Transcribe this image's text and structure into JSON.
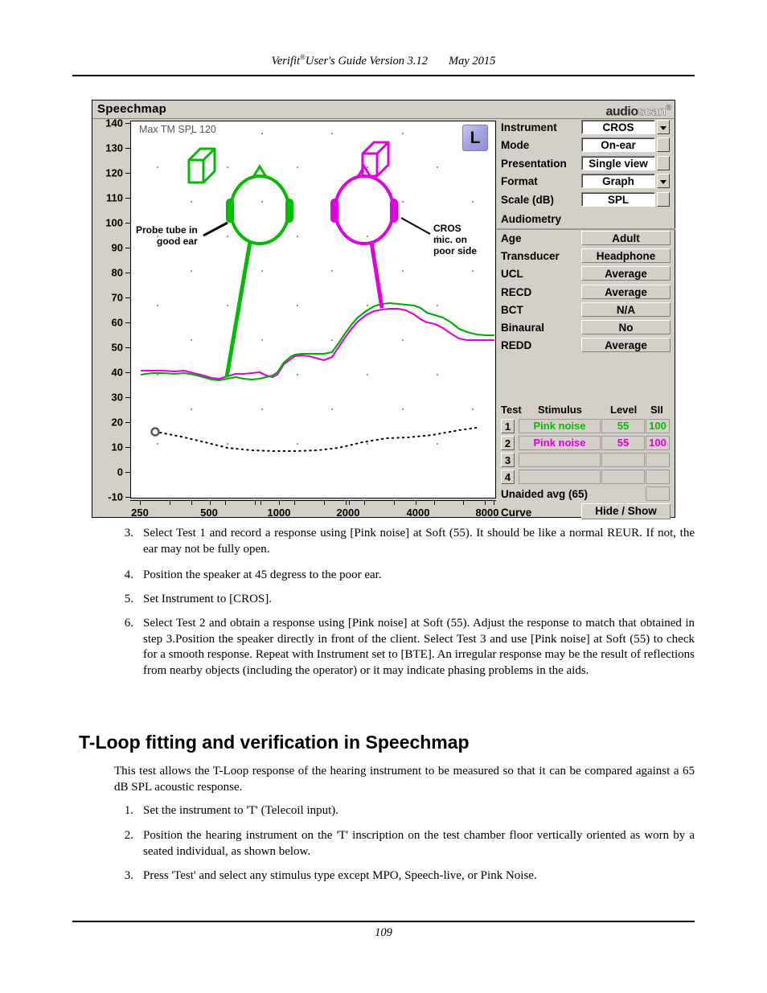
{
  "document": {
    "running_head": {
      "title": "Verifit",
      "registered": "®",
      "subtitle": "User's Guide Version 3.12",
      "date": "May 2015"
    },
    "page_number": "109"
  },
  "app": {
    "title": "Speechmap",
    "logo": {
      "part1": "audio",
      "part2": "scan",
      "mark": "®"
    },
    "ear_button": "L",
    "max_tm_spl": "Max TM SPL 120",
    "controls": [
      {
        "label": "Instrument",
        "value": "CROS",
        "has_dropdown": true
      },
      {
        "label": "Mode",
        "value": "On-ear",
        "has_dropdown": false
      },
      {
        "label": "Presentation",
        "value": "Single view",
        "has_dropdown": false
      },
      {
        "label": "Format",
        "value": "Graph",
        "has_dropdown": true
      },
      {
        "label": "Scale (dB)",
        "value": "SPL",
        "has_dropdown": false
      }
    ],
    "audiometry": {
      "section_title": "Audiometry",
      "rows": [
        {
          "label": "Age",
          "value": "Adult"
        },
        {
          "label": "Transducer",
          "value": "Headphone"
        },
        {
          "label": "UCL",
          "value": "Average"
        },
        {
          "label": "RECD",
          "value": "Average"
        },
        {
          "label": "BCT",
          "value": "N/A"
        },
        {
          "label": "Binaural",
          "value": "No"
        },
        {
          "label": "REDD",
          "value": "Average"
        }
      ]
    },
    "test_table": {
      "headers": {
        "test": "Test",
        "stimulus": "Stimulus",
        "level": "Level",
        "sii": "SII"
      },
      "rows": [
        {
          "num": "1",
          "stimulus": "Pink noise",
          "level": "55",
          "sii": "100",
          "color": "#00c000"
        },
        {
          "num": "2",
          "stimulus": "Pink noise",
          "level": "55",
          "sii": "100",
          "color": "#e000e0"
        },
        {
          "num": "3",
          "stimulus": "",
          "level": "",
          "sii": "",
          "color": "#000000"
        },
        {
          "num": "4",
          "stimulus": "",
          "level": "",
          "sii": "",
          "color": "#000000"
        }
      ],
      "unaided_label": "Unaided avg (65)",
      "unaided_value": "",
      "curve_label": "Curve",
      "curve_button": "Hide / Show"
    },
    "annotations": {
      "probe_tube": [
        "Probe tube in",
        "good ear"
      ],
      "cros_mic": [
        "CROS",
        "mic. on",
        "poor side"
      ]
    }
  },
  "chart_data": {
    "type": "line",
    "title": "Speechmap",
    "xlabel": "",
    "ylabel": "",
    "xscale": "log",
    "xlim": [
      200,
      9000
    ],
    "ylim": [
      -10,
      140
    ],
    "xticks": [
      250,
      500,
      1000,
      2000,
      4000,
      8000
    ],
    "xticklabels": [
      "250",
      "500",
      "1000",
      "2000",
      "4000",
      "8000"
    ],
    "yticks": [
      -10,
      0,
      10,
      20,
      30,
      40,
      50,
      60,
      70,
      80,
      90,
      100,
      110,
      120,
      130,
      140
    ],
    "yticklabels": [
      "-10",
      "0",
      "10",
      "20",
      "30",
      "40",
      "50",
      "60",
      "70",
      "80",
      "90",
      "100",
      "110",
      "120",
      "130",
      "140"
    ],
    "grid": "dots",
    "legend": "none",
    "colors": {
      "test1": "#00bb00",
      "test2": "#e000e0",
      "threshold": "#000000"
    },
    "series": [
      {
        "name": "Test 1 Pink noise 55 (good ear, probe tube)",
        "color": "#00bb00",
        "x": [
          200,
          230,
          260,
          300,
          340,
          390,
          440,
          500,
          570,
          650,
          740,
          840,
          950,
          1080,
          1230,
          1400,
          1600,
          1800,
          2050,
          2330,
          2650,
          3000,
          3400,
          3900,
          4400,
          5000,
          5700,
          6500,
          7400,
          8400,
          9000
        ],
        "values": [
          43,
          43,
          42,
          42,
          43,
          43,
          42,
          41,
          40,
          40,
          41,
          42,
          41,
          41,
          43,
          46,
          48,
          48,
          48,
          52,
          58,
          63,
          66,
          67,
          66,
          65,
          63,
          60,
          57,
          54,
          53
        ]
      },
      {
        "name": "Test 2 Pink noise 55 (CROS mic on poor side)",
        "color": "#e000e0",
        "x": [
          200,
          230,
          260,
          300,
          340,
          390,
          440,
          500,
          570,
          650,
          740,
          840,
          950,
          1080,
          1230,
          1400,
          1600,
          1800,
          2050,
          2330,
          2650,
          3000,
          3400,
          3900,
          4400,
          5000,
          5700,
          6500,
          7400,
          8400,
          9000
        ],
        "values": [
          44,
          44,
          44,
          44,
          44,
          44,
          43,
          41,
          41,
          42,
          43,
          43,
          42,
          42,
          44,
          46,
          47,
          46,
          46,
          51,
          57,
          62,
          64,
          64,
          62,
          59,
          56,
          53,
          51,
          50,
          50
        ]
      },
      {
        "name": "Threshold (dotted)",
        "color": "#000000",
        "style": "dotted",
        "marker_at": {
          "x": 250,
          "y": 18
        },
        "x": [
          250,
          340,
          440,
          570,
          740,
          950,
          1230,
          1600,
          2050,
          2650,
          3400,
          4400,
          5700,
          7400,
          8400
        ],
        "values": [
          18,
          16,
          13,
          11,
          10,
          10,
          10,
          10,
          11,
          14,
          15,
          15,
          16,
          18,
          19
        ]
      }
    ],
    "pointer_lines": [
      {
        "name": "green-head-pointer",
        "color": "#00bb00",
        "from": [
          1650,
          100
        ],
        "to": [
          1330,
          43
        ]
      },
      {
        "name": "magenta-head-pointer",
        "color": "#e000e0",
        "from": [
          3200,
          100
        ],
        "to": [
          3400,
          64
        ]
      }
    ],
    "icons": [
      {
        "name": "speaker-icon-green",
        "color": "#00bb00"
      },
      {
        "name": "speaker-icon-magenta",
        "color": "#e000e0"
      },
      {
        "name": "head-icon-green",
        "color": "#00bb00"
      },
      {
        "name": "head-icon-magenta",
        "color": "#e000e0"
      }
    ]
  },
  "body": {
    "steps_top": [
      {
        "num": "3.",
        "text": "Select Test 1 and record a response using [Pink noise] at Soft (55). It should be like a normal REUR. If not, the ear may not be fully open."
      },
      {
        "num": "4.",
        "text": "Position the speaker at 45 degress to the poor ear."
      },
      {
        "num": "5.",
        "text": "Set Instrument to [CROS]."
      },
      {
        "num": "6.",
        "text": "Select Test 2 and obtain a response using [Pink noise] at Soft (55). Adjust the response to match that obtained in step 3.Position the speaker directly in front of the client. Select Test 3 and use [Pink noise] at Soft (55) to check for a smooth response. Repeat with Instrument set to [BTE]. An irregular response may be the result of reflections from nearby objects (including the operator) or it may indicate phasing problems in the aids."
      }
    ],
    "section_heading": "T-Loop fitting and verification in Speechmap",
    "intro_paragraph": "This test allows the T-Loop response of the hearing instrument to be measured so that it can be compared against a 65 dB SPL acoustic response.",
    "steps_bottom": [
      {
        "num": "1.",
        "text": "Set the instrument to 'T' (Telecoil input)."
      },
      {
        "num": "2.",
        "text": "Position the hearing instrument on the 'T' inscription on the test chamber floor vertically oriented as worn by a seated individual, as shown below."
      },
      {
        "num": "3.",
        "text": "Press 'Test' and select any stimulus type except MPO, Speech-live, or Pink Noise."
      }
    ]
  }
}
